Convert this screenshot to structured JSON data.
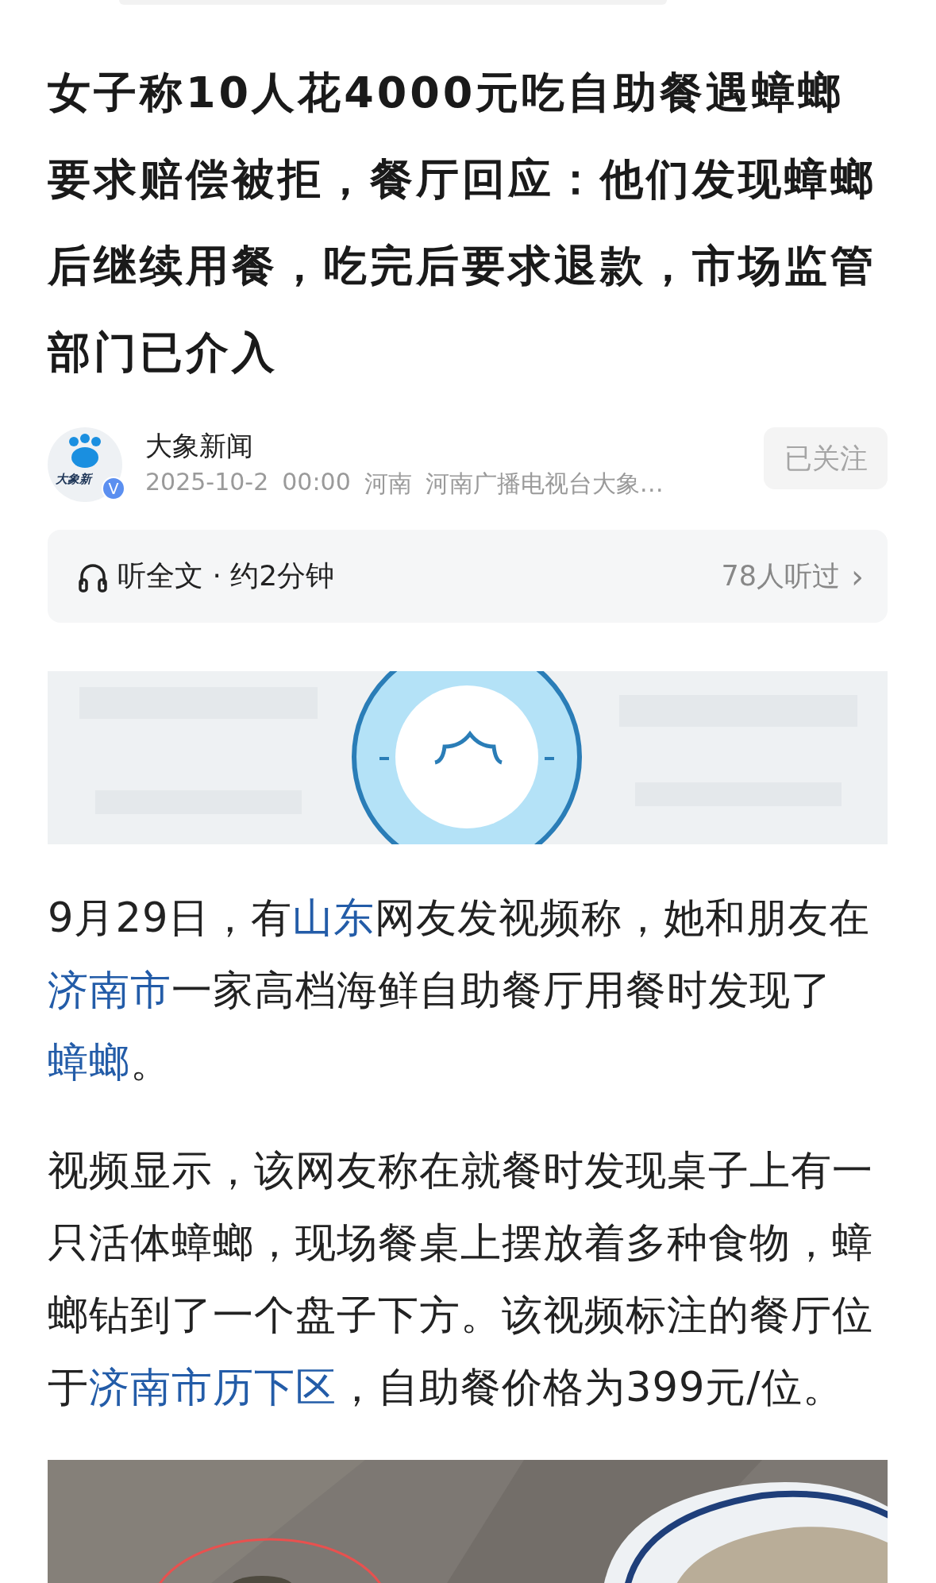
{
  "title": "女子称10人花4000元吃自助餐遇蟑螂要求赔偿被拒，餐厅回应：他们发现蟑螂后继续用餐，吃完后要求退款，市场监管部门已介入",
  "author": {
    "avatar_text": "大象新",
    "verified_badge": "V",
    "name": "大象新闻",
    "date": "2025-10-2",
    "time": "00:00",
    "region": "河南",
    "source": "河南广播电视台大象…",
    "follow_button": "已关注"
  },
  "listen_bar": {
    "label": "听全文 · 约2分钟",
    "listeners": "78人听过",
    "chevron": "›"
  },
  "paragraphs": [
    [
      {
        "text": "9月29日，有",
        "link": false
      },
      {
        "text": "山东",
        "link": true
      },
      {
        "text": "网友发视频称，她和朋友在",
        "link": false
      },
      {
        "text": "济南市",
        "link": true
      },
      {
        "text": "一家高档海鲜自助餐厅用餐时发现了",
        "link": false
      },
      {
        "text": "蟑螂",
        "link": true
      },
      {
        "text": "。",
        "link": false
      }
    ],
    [
      {
        "text": "视频显示，该网友称在就餐时发现桌子上有一只活体蟑螂，现场餐桌上摆放着多种食物，蟑螂钻到了一个盘子下方。该视频标注的餐厅位于",
        "link": false
      },
      {
        "text": "济南市历下区",
        "link": true
      },
      {
        "text": "，自助餐价格为399元/位。",
        "link": false
      }
    ]
  ]
}
